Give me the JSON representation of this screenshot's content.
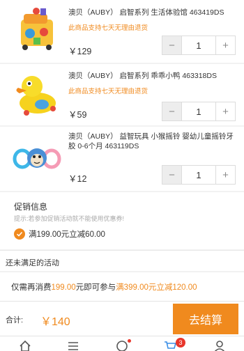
{
  "items": [
    {
      "title": "澳贝（AUBY） 启智系列 生活体验馆 463419DS",
      "promo_note": "此商品支持七天无理由退货",
      "price": "￥129",
      "quantity": "1",
      "minus": "−",
      "plus": "+",
      "icon": "baby-activity-cube-toy-image"
    },
    {
      "title": "澳贝（AUBY） 启智系列 乖乖小鸭 463318DS",
      "promo_note": "此商品支持七天无理由退货",
      "price": "￥59",
      "quantity": "1",
      "minus": "−",
      "plus": "+",
      "icon": "yellow-duck-toy-image"
    },
    {
      "title": "澳贝（AUBY） 益智玩具 小猴摇铃 婴幼儿童摇铃牙胶 0-6个月 463119DS",
      "price": "￥12",
      "quantity": "1",
      "minus": "−",
      "plus": "+",
      "icon": "monkey-rattle-teether-image"
    }
  ],
  "promotions": {
    "title": "促销信息",
    "hint": "提示:若参加促销活动就不能使用优惠券!",
    "selected": "满199.00元立减60.00"
  },
  "unmet": {
    "title": "还未满足的活动",
    "prefix": "仅需再消费",
    "amount": "199.00",
    "mid": "元即可参与",
    "offer": "满399.00元立减120.00"
  },
  "footer": {
    "total_label": "合计:",
    "total": "￥140",
    "checkout": "去结算"
  },
  "tabbar": {
    "cart_badge": "3"
  },
  "colors": {
    "accent": "#f08a1e",
    "badge": "#e8362b"
  }
}
